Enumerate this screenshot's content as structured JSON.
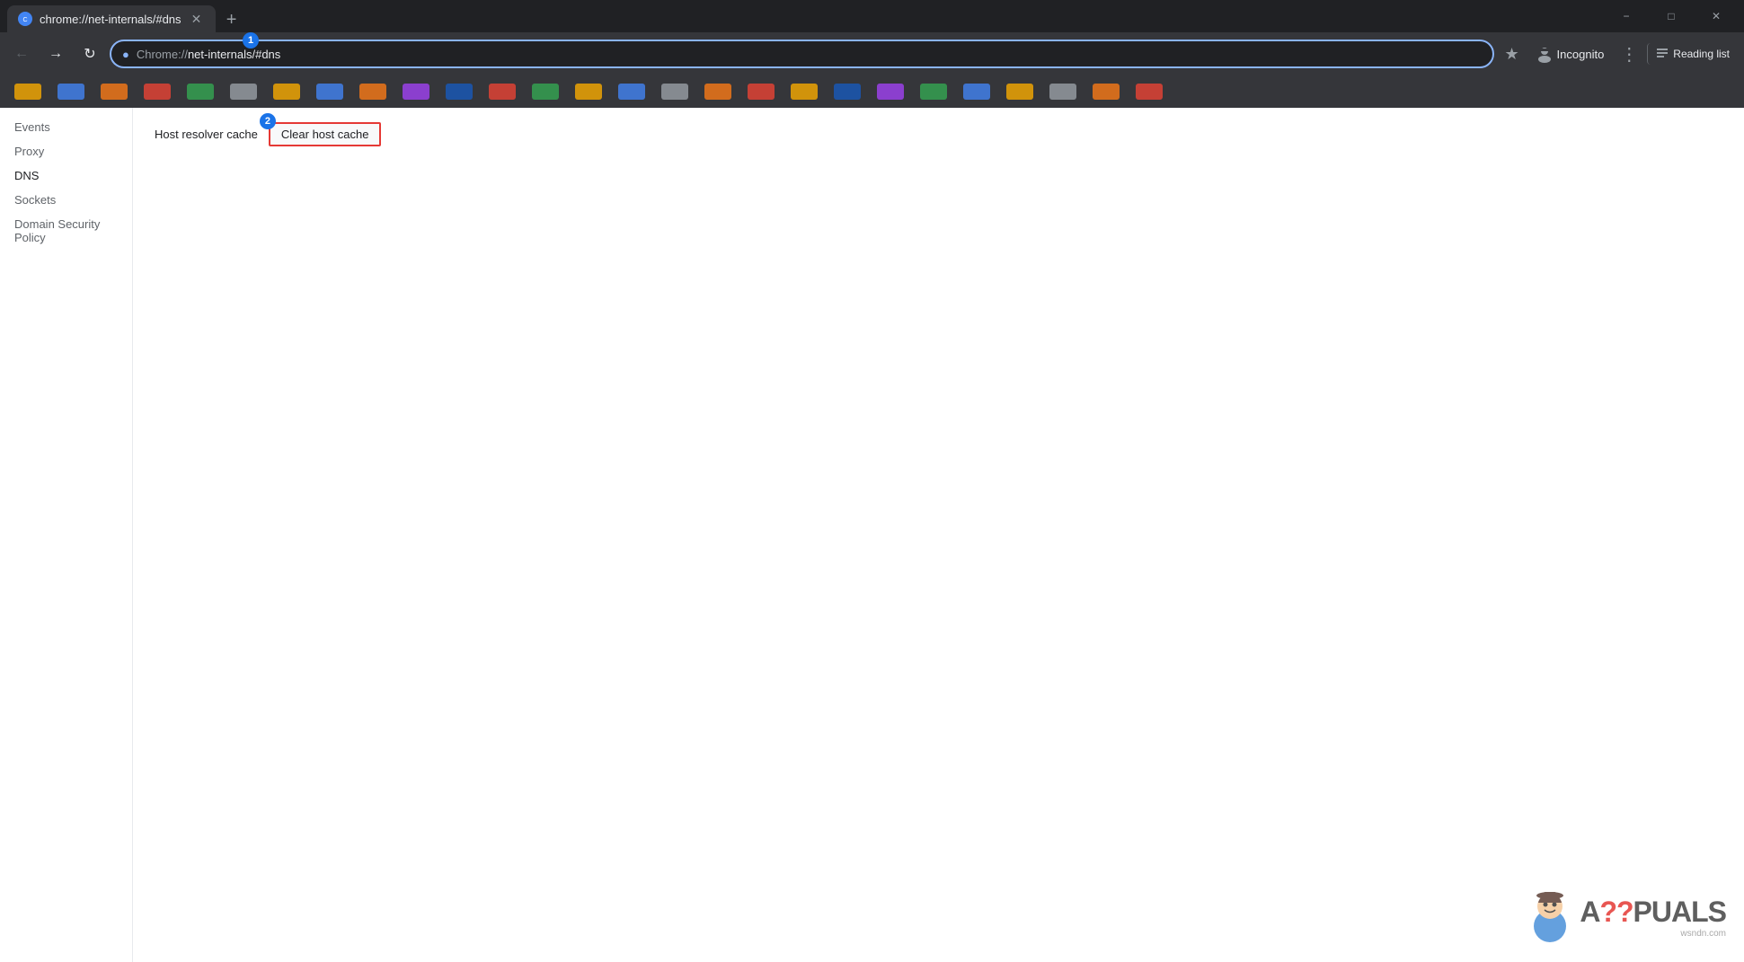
{
  "browser": {
    "tab": {
      "title": "chrome://net-internals/#dns",
      "favicon_color": "#4285f4"
    },
    "address_bar": {
      "url_prefix": "Chrome://",
      "url_highlight": "net-internals/#dns",
      "full_url": "chrome://net-internals/#dns"
    },
    "incognito_label": "Incognito",
    "reading_list_label": "Reading list",
    "new_tab_label": "+",
    "annotation_1": "1",
    "annotation_2": "2"
  },
  "sidebar": {
    "items": [
      {
        "label": "Events",
        "active": false
      },
      {
        "label": "Proxy",
        "active": false
      },
      {
        "label": "DNS",
        "active": true
      },
      {
        "label": "Sockets",
        "active": false
      },
      {
        "label": "Domain Security Policy",
        "active": false
      }
    ]
  },
  "main": {
    "section_label": "Host resolver cache",
    "clear_button_label": "Clear host cache"
  },
  "watermark": {
    "text": "A??PUALS",
    "site": "wsndn.com"
  }
}
